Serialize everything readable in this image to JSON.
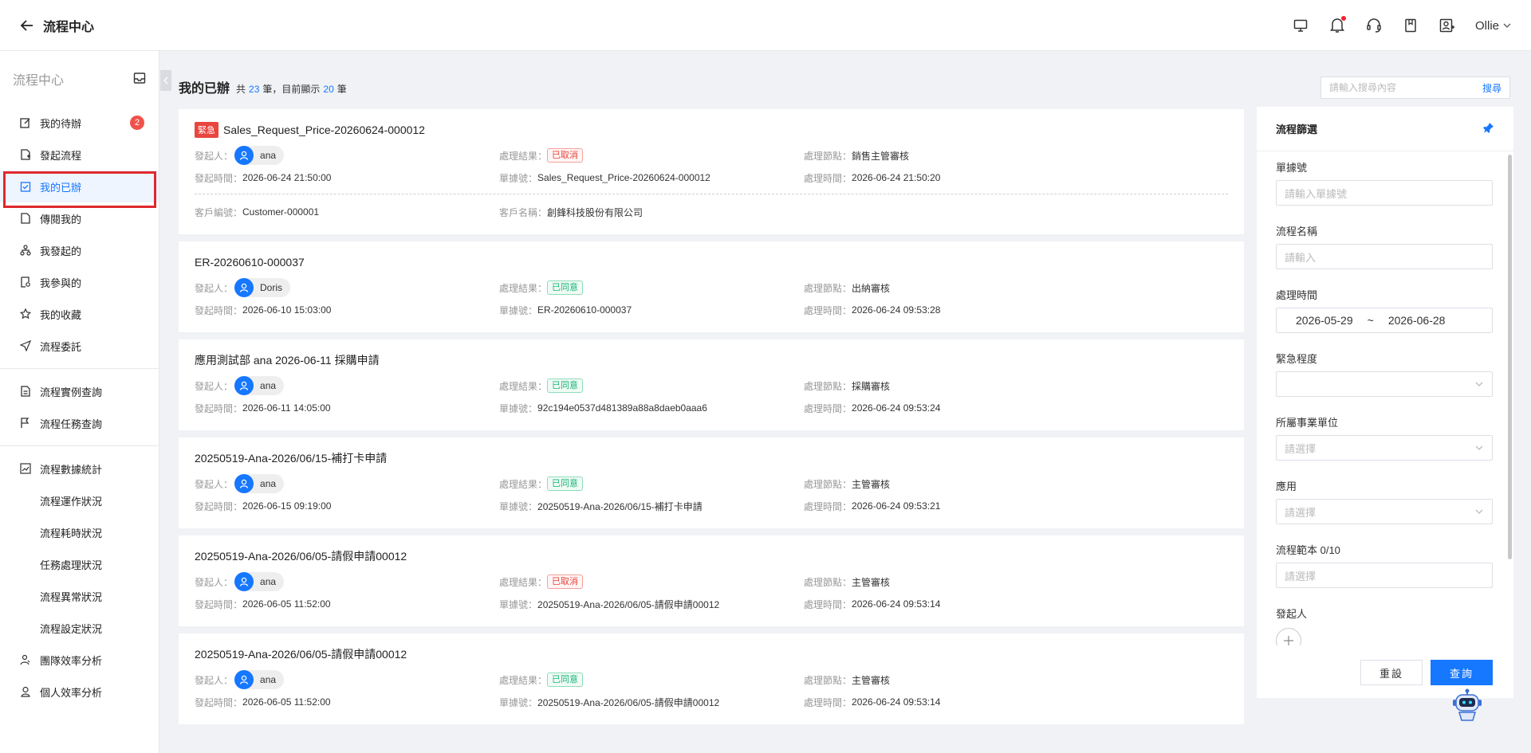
{
  "topbar": {
    "title": "流程中心",
    "user": "Ollie"
  },
  "sidebar": {
    "title": "流程中心",
    "group1": [
      {
        "label": "我的待辦",
        "badge": "2"
      },
      {
        "label": "發起流程"
      },
      {
        "label": "我的已辦"
      },
      {
        "label": "傳閱我的"
      },
      {
        "label": "我發起的"
      },
      {
        "label": "我參與的"
      },
      {
        "label": "我的收藏"
      },
      {
        "label": "流程委託"
      }
    ],
    "group2": [
      {
        "label": "流程實例查詢"
      },
      {
        "label": "流程任務查詢"
      }
    ],
    "group3_head": "流程數據統計",
    "group3_subs": [
      "流程運作狀況",
      "流程耗時狀況",
      "任務處理狀況",
      "流程異常狀況",
      "流程設定狀況"
    ],
    "group4": [
      {
        "label": "團隊效率分析"
      },
      {
        "label": "個人效率分析"
      }
    ]
  },
  "main": {
    "title": "我的已辦",
    "count_pre": "共",
    "total": "23",
    "count_mid": "筆，目前顯示",
    "shown": "20",
    "count_post": "筆",
    "search_placeholder": "請輸入搜尋內容",
    "search_btn": "搜尋"
  },
  "labels": {
    "initiator": "發起人：",
    "result": "處理結果：",
    "node": "處理節點：",
    "start_time": "發起時間：",
    "doc_no": "單據號：",
    "proc_time": "處理時間：",
    "customer_no": "客戶編號：",
    "customer_name": "客戶名稱："
  },
  "cards": [
    {
      "urgent": "緊急",
      "title": "Sales_Request_Price-20260624-000012",
      "initiator": "ana",
      "result": "已取消",
      "result_type": "red",
      "node": "銷售主管審核",
      "start_time": "2026-06-24 21:50:00",
      "doc_no": "Sales_Request_Price-20260624-000012",
      "proc_time": "2026-06-24 21:50:20",
      "customer_no": "Customer-000001",
      "customer_name": "創鋒科技股份有限公司"
    },
    {
      "title": "ER-20260610-000037",
      "initiator": "Doris",
      "result": "已同意",
      "result_type": "green",
      "node": "出納審核",
      "start_time": "2026-06-10 15:03:00",
      "doc_no": "ER-20260610-000037",
      "proc_time": "2026-06-24 09:53:28"
    },
    {
      "title": "應用測試部 ana 2026-06-11 採購申請",
      "initiator": "ana",
      "result": "已同意",
      "result_type": "green",
      "node": "採購審核",
      "start_time": "2026-06-11 14:05:00",
      "doc_no": "92c194e0537d481389a88a8daeb0aaa6",
      "proc_time": "2026-06-24 09:53:24"
    },
    {
      "title": "20250519-Ana-2026/06/15-補打卡申請",
      "initiator": "ana",
      "result": "已同意",
      "result_type": "green",
      "node": "主管審核",
      "start_time": "2026-06-15 09:19:00",
      "doc_no": "20250519-Ana-2026/06/15-補打卡申請",
      "proc_time": "2026-06-24 09:53:21"
    },
    {
      "title": "20250519-Ana-2026/06/05-請假申請00012",
      "initiator": "ana",
      "result": "已取消",
      "result_type": "red",
      "node": "主管審核",
      "start_time": "2026-06-05 11:52:00",
      "doc_no": "20250519-Ana-2026/06/05-請假申請00012",
      "proc_time": "2026-06-24 09:53:14"
    },
    {
      "title": "20250519-Ana-2026/06/05-請假申請00012",
      "initiator": "ana",
      "result": "已同意",
      "result_type": "green",
      "node": "主管審核",
      "start_time": "2026-06-05 11:52:00",
      "doc_no": "20250519-Ana-2026/06/05-請假申請00012",
      "proc_time": "2026-06-24 09:53:14"
    }
  ],
  "filter": {
    "title": "流程篩選",
    "doc_no_label": "單據號",
    "doc_no_placeholder": "請輸入單據號",
    "name_label": "流程名稱",
    "name_placeholder": "請輸入",
    "time_label": "處理時間",
    "date_from": "2026-05-29",
    "date_sep": "~",
    "date_to": "2026-06-28",
    "urgency_label": "緊急程度",
    "unit_label": "所屬事業單位",
    "unit_placeholder": "請選擇",
    "app_label": "應用",
    "app_placeholder": "請選擇",
    "template_label": "流程範本 0/10",
    "template_placeholder": "請選擇",
    "initiator_label": "發起人",
    "reset": "重設",
    "query": "查詢"
  },
  "colors": {
    "accent": "#1677ff",
    "urgent": "#e8463f",
    "success": "#1ab678",
    "highlight_box": "#e0282e"
  }
}
